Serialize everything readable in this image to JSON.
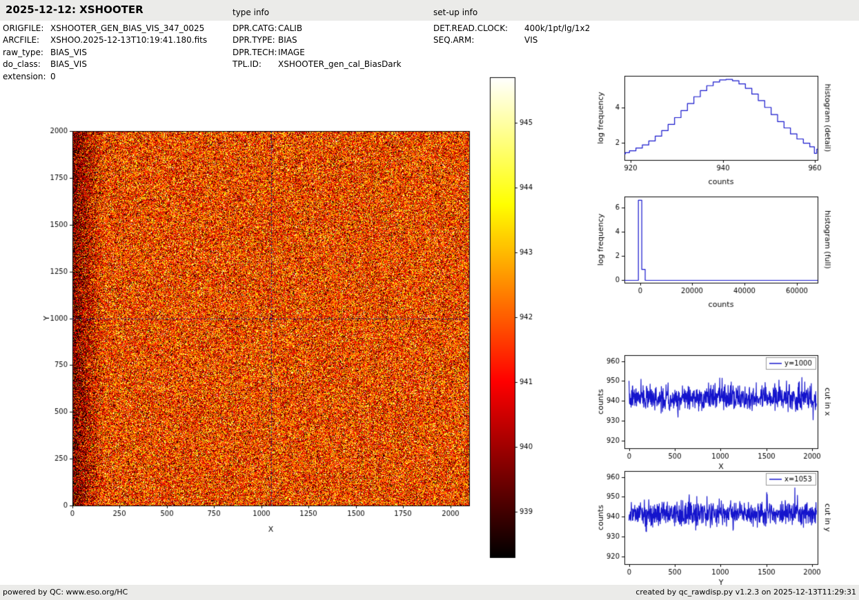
{
  "header": {
    "title": "2025-12-12: XSHOOTER",
    "type_info_label": "type info",
    "setup_info_label": "set-up info"
  },
  "file_info": {
    "rows": [
      {
        "label": "ORIGFILE:",
        "value": "XSHOOTER_GEN_BIAS_VIS_347_0025"
      },
      {
        "label": "ARCFILE:",
        "value": "XSHOO.2025-12-13T10:19:41.180.fits"
      },
      {
        "label": "raw_type:",
        "value": "BIAS_VIS"
      },
      {
        "label": "do_class:",
        "value": "BIAS_VIS"
      },
      {
        "label": "extension:",
        "value": "0"
      }
    ]
  },
  "type_info": {
    "rows": [
      {
        "label": "DPR.CATG:",
        "value": "CALIB"
      },
      {
        "label": "DPR.TYPE:",
        "value": "BIAS"
      },
      {
        "label": "DPR.TECH:",
        "value": "IMAGE"
      },
      {
        "label": "TPL.ID:",
        "value": "XSHOOTER_gen_cal_BiasDark"
      }
    ]
  },
  "setup_info": {
    "rows": [
      {
        "label": "DET.READ.CLOCK:",
        "value": "400k/1pt/lg/1x2"
      },
      {
        "label": "SEQ.ARM:",
        "value": "VIS"
      }
    ]
  },
  "footer": {
    "left": "powered by QC: www.eso.org/HC",
    "right": "created by qc_rawdisp.py v1.2.3 on 2025-12-13T11:29:31"
  },
  "colors": {
    "line_blue": "#1414cc",
    "crosshair": "#1a1a7a",
    "frame": "#000000",
    "bar_bg": "#ebebe9"
  },
  "chart_data": [
    {
      "id": "bias_image",
      "type": "heatmap",
      "xlabel": "X",
      "ylabel": "Y",
      "xlim": [
        0,
        2100
      ],
      "ylim": [
        0,
        2000
      ],
      "xticks": [
        0,
        250,
        500,
        750,
        1000,
        1250,
        1500,
        1750,
        2000
      ],
      "yticks": [
        0,
        250,
        500,
        750,
        1000,
        1250,
        1500,
        1750,
        2000
      ],
      "colormap": "hot",
      "value_range": [
        938.3,
        945.7
      ],
      "image_stats": {
        "mean": 941.6,
        "std": 1.7,
        "left_dark_band_width": 170,
        "left_dark_band_depth": 2.0,
        "seed": 42
      },
      "crosshair": {
        "x": 1053,
        "y": 1000
      },
      "colorbar_ticks": [
        939,
        940,
        941,
        942,
        943,
        944,
        945
      ]
    },
    {
      "id": "histogram_detail",
      "type": "line",
      "right_label": "histogram (detail)",
      "xlabel": "counts",
      "ylabel": "log frequency",
      "xlim": [
        918.6,
        960.6
      ],
      "ylim": [
        1.0,
        5.8
      ],
      "xticks": [
        920,
        940,
        960
      ],
      "yticks": [
        2,
        4
      ],
      "series": [
        {
          "step": true,
          "x": [
            918.6,
            919,
            920.4,
            921.8,
            923.2,
            924.6,
            926,
            927.4,
            928.8,
            930.2,
            931.6,
            933,
            934.4,
            935.8,
            937.2,
            938.6,
            940,
            941.4,
            942.8,
            944.2,
            945.6,
            947,
            948.4,
            949.8,
            951.2,
            952.6,
            954,
            955.4,
            956.8,
            958.2,
            959.6,
            960.2,
            960.6
          ],
          "y": [
            1.35,
            1.42,
            1.53,
            1.68,
            1.86,
            2.09,
            2.36,
            2.68,
            3.03,
            3.42,
            3.82,
            4.22,
            4.61,
            4.96,
            5.24,
            5.45,
            5.57,
            5.6,
            5.52,
            5.34,
            5.09,
            4.76,
            4.39,
            4.0,
            3.59,
            3.19,
            2.83,
            2.49,
            2.2,
            1.96,
            1.75,
            1.38,
            1.62
          ]
        }
      ]
    },
    {
      "id": "histogram_full",
      "type": "line",
      "right_label": "histogram (full)",
      "xlabel": "counts",
      "ylabel": "log frequency",
      "xlim": [
        -6000,
        68000
      ],
      "ylim": [
        -0.2,
        6.9
      ],
      "xticks": [
        0,
        20000,
        40000,
        60000
      ],
      "yticks": [
        0,
        2,
        4,
        6
      ],
      "series": [
        {
          "x": [
            -6000,
            -650,
            -650,
            650,
            650,
            1950,
            1950,
            68000
          ],
          "y": [
            0,
            0,
            6.6,
            6.6,
            0.9,
            0.9,
            0,
            0
          ]
        }
      ]
    },
    {
      "id": "cut_x",
      "type": "line",
      "right_label": "cut in x",
      "legend": "y=1000",
      "xlabel": "X",
      "ylabel": "counts",
      "xlim": [
        -50,
        2060
      ],
      "ylim": [
        916,
        963
      ],
      "xticks": [
        0,
        500,
        1000,
        1500,
        2000
      ],
      "yticks": [
        920,
        930,
        940,
        950,
        960
      ],
      "series": [
        {
          "noise": {
            "mean": 941.5,
            "std": 3.1,
            "n": 720,
            "xmax": 2048,
            "seed": 7
          }
        }
      ]
    },
    {
      "id": "cut_y",
      "type": "line",
      "right_label": "cut in y",
      "legend": "x=1053",
      "xlabel": "Y",
      "ylabel": "counts",
      "xlim": [
        -50,
        2060
      ],
      "ylim": [
        916,
        963
      ],
      "xticks": [
        0,
        500,
        1000,
        1500,
        2000
      ],
      "yticks": [
        920,
        930,
        940,
        950,
        960
      ],
      "series": [
        {
          "noise": {
            "mean": 941.5,
            "std": 3.1,
            "n": 720,
            "xmax": 2048,
            "seed": 11
          }
        }
      ]
    }
  ]
}
